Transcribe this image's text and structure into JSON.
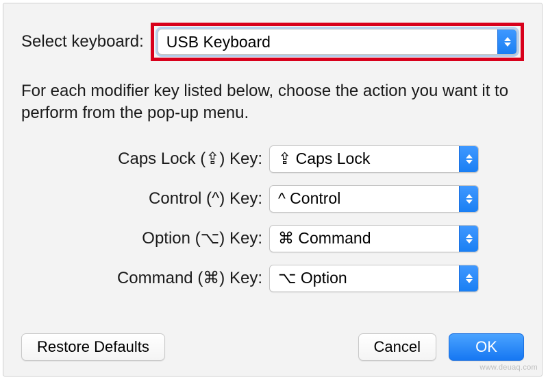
{
  "select_keyboard": {
    "label": "Select keyboard:",
    "value": "USB Keyboard"
  },
  "description": "For each modifier key listed below, choose the action you want it to perform from the pop-up menu.",
  "modifiers": {
    "caps_lock": {
      "label": "Caps Lock (⇪) Key:",
      "value": "⇪ Caps Lock"
    },
    "control": {
      "label": "Control (^) Key:",
      "value": "^ Control"
    },
    "option": {
      "label": "Option (⌥) Key:",
      "value": "⌘ Command"
    },
    "command": {
      "label": "Command (⌘) Key:",
      "value": "⌥ Option"
    }
  },
  "buttons": {
    "restore": "Restore Defaults",
    "cancel": "Cancel",
    "ok": "OK"
  },
  "watermark": "www.deuaq.com"
}
